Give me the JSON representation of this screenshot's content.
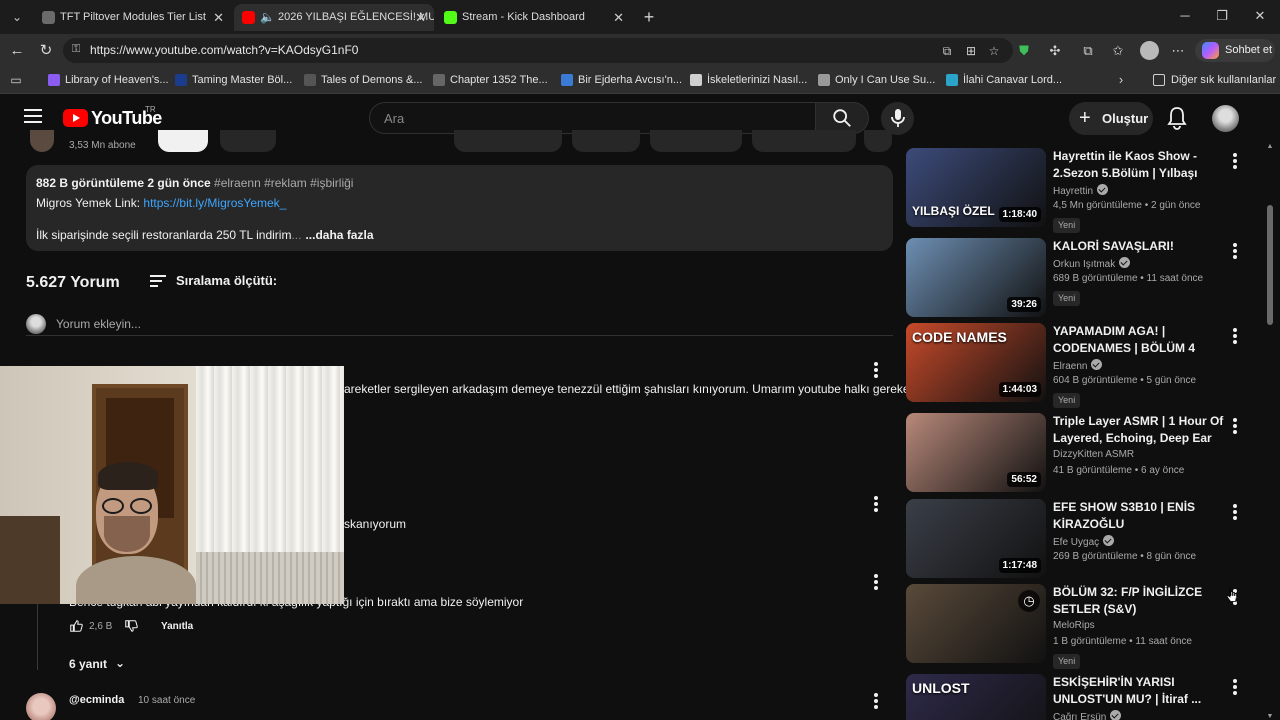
{
  "browser": {
    "tabs": [
      {
        "title": "TFT Piltover Modules Tier List",
        "favicon_color": "#6b6b6b"
      },
      {
        "title": "2026 YILBAŞI EĞLENCESİ! MU",
        "favicon_color": "#ff0000"
      },
      {
        "title": "Stream - Kick Dashboard",
        "favicon_color": "#53fc18"
      }
    ],
    "url": "https://www.youtube.com/watch?v=KAOdsyG1nF0",
    "copilot_label": "Sohbet et",
    "bookmarks": [
      {
        "label": "Library of Heaven's...",
        "color": "#8a5cf0"
      },
      {
        "label": "Taming Master Böl...",
        "color": "#1b3b8c"
      },
      {
        "label": "Tales of Demons &...",
        "color": "#555555"
      },
      {
        "label": "Chapter 1352 The...",
        "color": "#666666"
      },
      {
        "label": "Bir Ejderha Avcısı'n...",
        "color": "#3a7bd5"
      },
      {
        "label": "İskeletlerinizi Nasıl...",
        "color": "#cfcfcf"
      },
      {
        "label": "Only I Can Use Su...",
        "color": "#999999"
      },
      {
        "label": "İlahi Canavar Lord...",
        "color": "#2aa5c9"
      }
    ],
    "bookmarks_more": "Diğer sık kullanılanlar"
  },
  "youtube": {
    "wordmark": "YouTube",
    "country": "TR",
    "search_placeholder": "Ara",
    "create_label": "Oluştur"
  },
  "video": {
    "subscribers": "3,53 Mn abone",
    "description": {
      "stats": "882 B görüntüleme  2 gün önce",
      "tags": "#elraenn #reklam #işbirliği",
      "link_label": "Migros Yemek Link: ",
      "link": "https://bit.ly/MigrosYemek_",
      "promo": "İlk siparişinde seçili restoranlarda 250 TL indirim",
      "promo_fade": "...",
      "more": "...daha fazla"
    }
  },
  "comments": {
    "count": "5.627 Yorum",
    "sort_label": "Sıralama ölçütü:",
    "add_placeholder": "Yorum ekleyin...",
    "c1_text": "areketler sergileyen arkadaşım demeye tenezzül ettiğim şahısları kınıyorum. Umarım youtube halkı gerekeni",
    "c2_text": "skanıyorum",
    "c3_text": "Bence tugkan abi yayından kaldırdı ki aşağılık yaptığı için bıraktı ama bize söylemiyor",
    "c3_likes": "2,6 B",
    "reply_label": "Yanıtla",
    "replies_label": "6 yanıt",
    "c4_author": "@ecminda",
    "c4_time": "10 saat önce"
  },
  "recommendations": [
    {
      "title": "Hayrettin ile Kaos Show - 2.Sezon 5.Bölüm | Yılbaşı Özel...",
      "channel": "Hayrettin",
      "verified": true,
      "meta": "4,5 Mn görüntüleme • 2 gün önce",
      "badge": "Yeni",
      "duration": "1:18:40",
      "thumb_text": "YILBAŞI ÖZEL",
      "thumb_color": "#3c4b7a"
    },
    {
      "title": "KALORİ SAVAŞLARI!",
      "channel": "Orkun Işıtmak",
      "verified": true,
      "meta": "689 B görüntüleme • 11 saat önce",
      "badge": "Yeni",
      "duration": "39:26",
      "thumb_text": "",
      "thumb_color": "#6d8fb3"
    },
    {
      "title": "YAPAMADIM AGA! | CODENAMES | BÖLÜM 4",
      "channel": "Elraenn",
      "verified": true,
      "meta": "604 B görüntüleme • 5 gün önce",
      "badge": "Yeni",
      "duration": "1:44:03",
      "thumb_text": "CODE NAMES",
      "thumb_color": "#c74a2a"
    },
    {
      "title": "Triple Layer ASMR | 1 Hour Of Layered, Echoing, Deep Ear ...",
      "channel": "DizzyKitten ASMR",
      "verified": false,
      "meta": "41 B görüntüleme • 6 ay önce",
      "badge": "",
      "duration": "56:52",
      "thumb_text": "",
      "thumb_color": "#b8897a"
    },
    {
      "title": "EFE SHOW S3B10 | ENİS KİRAZOĞLU",
      "channel": "Efe Uygaç",
      "verified": true,
      "meta": "269 B görüntüleme • 8 gün önce",
      "badge": "",
      "duration": "1:17:48",
      "thumb_text": "",
      "thumb_color": "#3a3f48"
    },
    {
      "title": "BÖLÜM 32: F/P İNGİLİZCE SETLER (S&V) HANGİLERİDİR...",
      "channel": "MeloRips",
      "verified": false,
      "meta": "1 B görüntüleme • 11 saat önce",
      "badge": "Yeni",
      "duration": "",
      "thumb_text": "",
      "thumb_color": "#5a4a3a"
    },
    {
      "title": "ESKİŞEHİR'İN YARISI UNLOST'UN MU? | İtiraf ...",
      "channel": "Çağrı Ersün",
      "verified": true,
      "meta": "",
      "badge": "",
      "duration": "",
      "thumb_text": "UNLOST",
      "thumb_color": "#2e2a4a"
    }
  ]
}
